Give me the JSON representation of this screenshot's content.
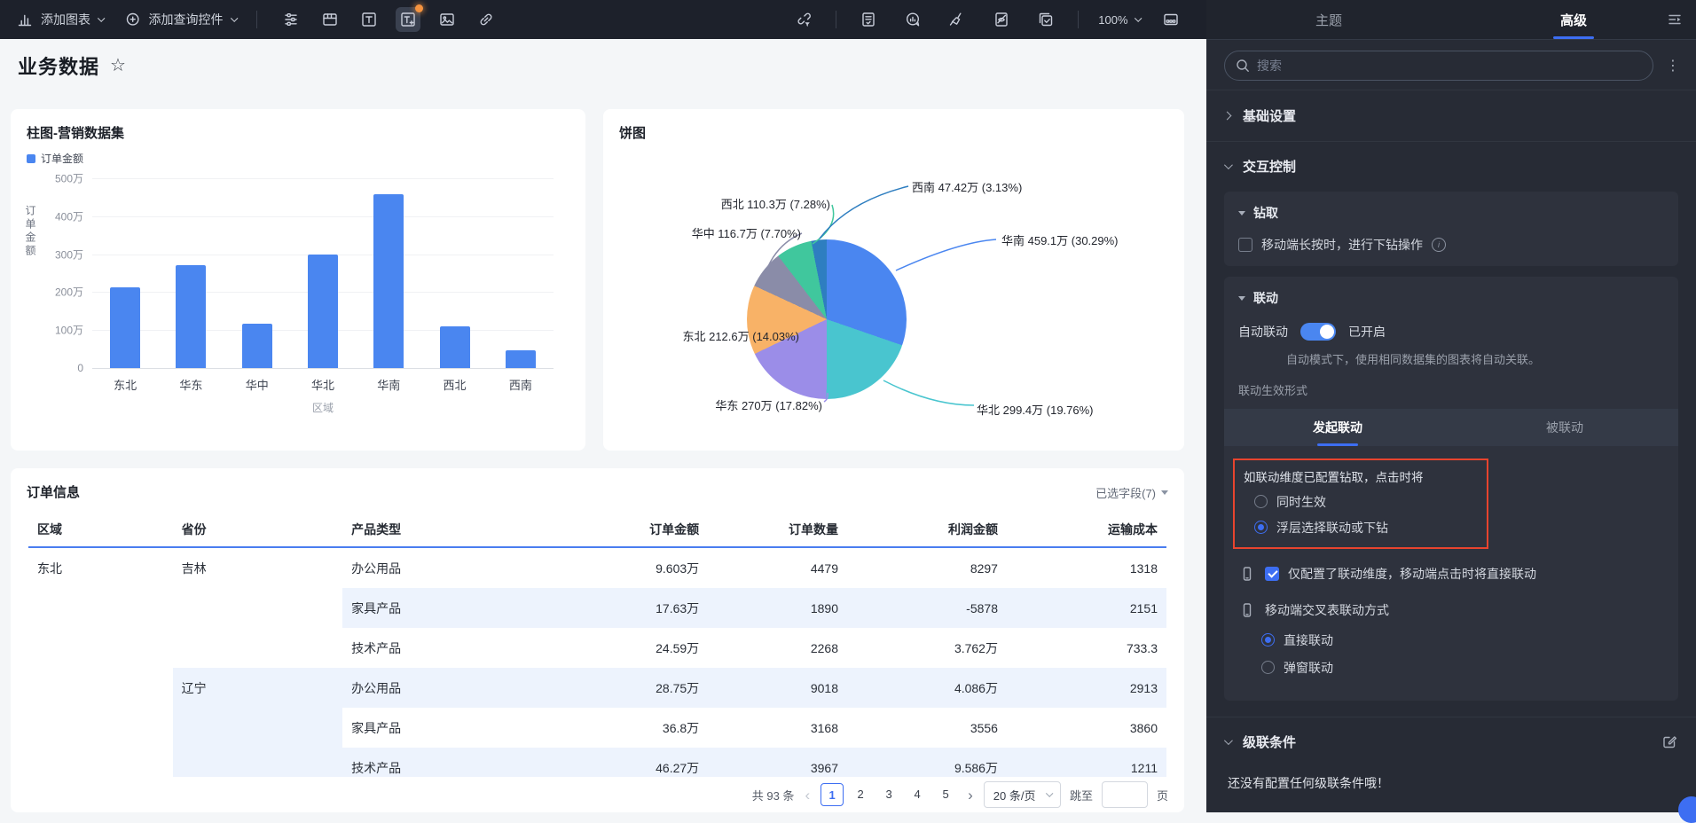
{
  "toolbar": {
    "add_chart_label": "添加图表",
    "add_query_label": "添加查询控件",
    "zoom_level": "100%",
    "icon_names": [
      "add-chart-icon",
      "add-query-icon",
      "slider-settings-icon",
      "tab-layout-icon",
      "text-component-icon",
      "rich-text-icon",
      "image-icon",
      "hyperlink-icon",
      "linkage-filter-icon",
      "note-doc-icon",
      "chat-analysis-icon",
      "clean-canvas-icon",
      "doc-hide-icon",
      "batch-select-icon",
      "zoom-control",
      "bottom-toolbar-icon"
    ]
  },
  "page": {
    "title": "业务数据"
  },
  "chart_data": [
    {
      "type": "bar",
      "title": "柱图-营销数据集",
      "series_name": "订单金额",
      "categories": [
        "东北",
        "华东",
        "华中",
        "华北",
        "华南",
        "西北",
        "西南"
      ],
      "values": [
        212.6,
        270,
        116.7,
        299.4,
        459.1,
        110.3,
        47.42
      ],
      "unit": "万",
      "xlabel": "区域",
      "ylabel": "订单金额",
      "ylim": [
        0,
        500
      ],
      "yticks": [
        "500万",
        "400万",
        "300万",
        "200万",
        "100万",
        "0"
      ],
      "grid": true,
      "legend_position": "top-left",
      "color": "#4A86F0"
    },
    {
      "type": "pie",
      "title": "饼图",
      "slices": [
        {
          "name": "华南",
          "value": "459.1万",
          "pct": 30.29,
          "pct_label": "30.29%",
          "color": "#4A86F0"
        },
        {
          "name": "华北",
          "value": "299.4万",
          "pct": 19.76,
          "pct_label": "19.76%",
          "color": "#49C5CF"
        },
        {
          "name": "华东",
          "value": "270万",
          "pct": 17.82,
          "pct_label": "17.82%",
          "color": "#9B8DE8"
        },
        {
          "name": "东北",
          "value": "212.6万",
          "pct": 14.03,
          "pct_label": "14.03%",
          "color": "#F8B267"
        },
        {
          "name": "华中",
          "value": "116.7万",
          "pct": 7.7,
          "pct_label": "7.70%",
          "color": "#8A8CA8"
        },
        {
          "name": "西北",
          "value": "110.3万",
          "pct": 7.28,
          "pct_label": "7.28%",
          "color": "#40C79D"
        },
        {
          "name": "西南",
          "value": "47.42万",
          "pct": 3.13,
          "pct_label": "3.13%",
          "color": "#2E7EC0"
        }
      ]
    }
  ],
  "table": {
    "title": "订单信息",
    "fields_selected": "已选字段(7)",
    "columns": [
      {
        "label": "区域"
      },
      {
        "label": "省份"
      },
      {
        "label": "产品类型"
      },
      {
        "label": "订单金额",
        "num": true
      },
      {
        "label": "订单数量",
        "num": true
      },
      {
        "label": "利润金额",
        "num": true
      },
      {
        "label": "运输成本",
        "num": true
      }
    ],
    "rows": [
      {
        "cells": [
          {
            "t": "东北",
            "rs": 6
          },
          {
            "t": "吉林",
            "rs": 3
          },
          {
            "t": "办公用品"
          },
          {
            "t": "9.603万",
            "num": true
          },
          {
            "t": "4479",
            "num": true
          },
          {
            "t": "8297",
            "num": true
          },
          {
            "t": "1318",
            "num": true
          }
        ]
      },
      {
        "cells": [
          {
            "t": "家具产品"
          },
          {
            "t": "17.63万",
            "num": true
          },
          {
            "t": "1890",
            "num": true
          },
          {
            "t": "-5878",
            "num": true
          },
          {
            "t": "2151",
            "num": true
          }
        ]
      },
      {
        "cells": [
          {
            "t": "技术产品"
          },
          {
            "t": "24.59万",
            "num": true
          },
          {
            "t": "2268",
            "num": true
          },
          {
            "t": "3.762万",
            "num": true
          },
          {
            "t": "733.3",
            "num": true
          }
        ]
      },
      {
        "cells": [
          {
            "t": "辽宁",
            "rs": 3
          },
          {
            "t": "办公用品"
          },
          {
            "t": "28.75万",
            "num": true
          },
          {
            "t": "9018",
            "num": true
          },
          {
            "t": "4.086万",
            "num": true
          },
          {
            "t": "2913",
            "num": true
          }
        ]
      },
      {
        "cells": [
          {
            "t": "家具产品"
          },
          {
            "t": "36.8万",
            "num": true
          },
          {
            "t": "3168",
            "num": true
          },
          {
            "t": "3556",
            "num": true
          },
          {
            "t": "3860",
            "num": true
          }
        ]
      },
      {
        "cells": [
          {
            "t": "技术产品"
          },
          {
            "t": "46.27万",
            "num": true
          },
          {
            "t": "3967",
            "num": true
          },
          {
            "t": "9.586万",
            "num": true
          },
          {
            "t": "1211",
            "num": true
          }
        ]
      }
    ]
  },
  "pagination": {
    "total": "共 93 条",
    "prev": "‹",
    "next": "›",
    "pages": [
      "1",
      "2",
      "3",
      "4",
      "5"
    ],
    "current": "1",
    "page_size": "20 条/页",
    "jump_label": "跳至",
    "page_unit": "页"
  },
  "panel": {
    "tabs": {
      "theme": "主题",
      "advanced": "高级"
    },
    "search_placeholder": "搜索",
    "basic_settings": "基础设置",
    "interaction_control": "交互控制",
    "drill": {
      "title": "钻取",
      "mobile_longpress": "移动端长按时，进行下钻操作"
    },
    "linkage": {
      "title": "联动",
      "auto_label": "自动联动",
      "auto_status": "已开启",
      "auto_desc": "自动模式下，使用相同数据集的图表将自动关联。",
      "effect_label": "联动生效形式",
      "tab_initiate": "发起联动",
      "tab_receive": "被联动",
      "drill_click_label": "如联动维度已配置钻取，点击时将",
      "option_simultaneous": "同时生效",
      "option_overlay": "浮层选择联动或下钻",
      "mobile_direct_label": "仅配置了联动维度，移动端点击时将直接联动",
      "crosstab_label": "移动端交叉表联动方式",
      "option_direct": "直接联动",
      "option_popup": "弹窗联动"
    },
    "cascade": {
      "title": "级联条件",
      "empty": "还没有配置任何级联条件哦！"
    }
  },
  "colors": {
    "accent": "#3D6EF2",
    "bar": "#4A86F0",
    "highlight_border": "#E8442E",
    "toggle_on": "#4A86F0",
    "stripe": "#EDF3FD",
    "badge": "#F5933F"
  }
}
